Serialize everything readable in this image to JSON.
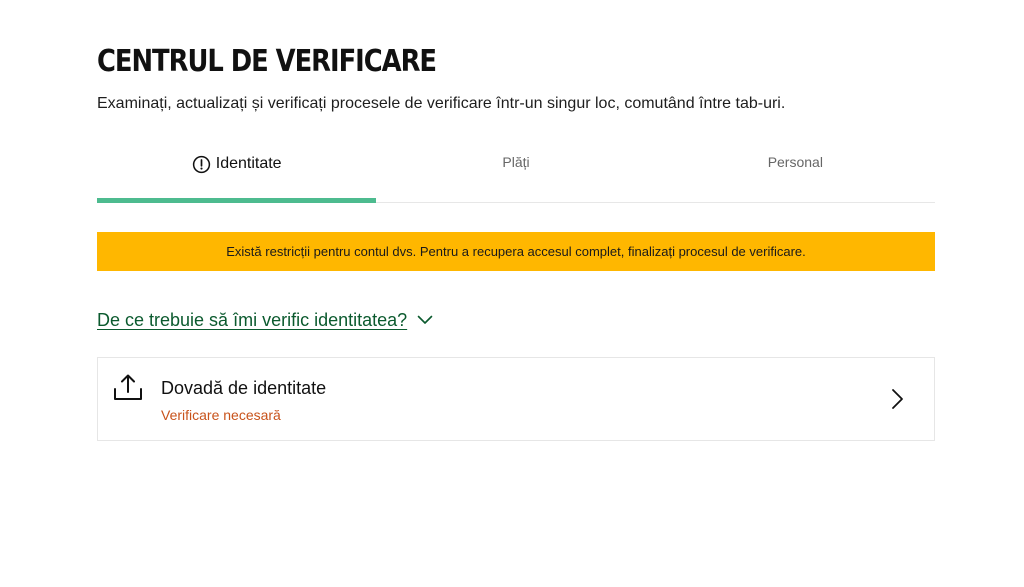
{
  "header": {
    "title": "CENTRUL DE VERIFICARE",
    "subtitle": "Examinați, actualizați și verificați procesele de verificare într-un singur loc, comutând între tab-uri."
  },
  "tabs": [
    {
      "label": "Identitate",
      "active": true,
      "icon": "alert-circle-icon"
    },
    {
      "label": "Plăți",
      "active": false
    },
    {
      "label": "Personal",
      "active": false
    }
  ],
  "alert": {
    "text": "Există restricții pentru contul dvs. Pentru a recupera accesul complet, finalizați procesul de verificare."
  },
  "faq": {
    "label": "De ce trebuie să îmi verific identitatea?",
    "icon": "chevron-down-icon"
  },
  "items": [
    {
      "title": "Dovadă de identitate",
      "status": "Verificare necesară",
      "icon": "upload-icon",
      "action_icon": "chevron-right-icon"
    }
  ],
  "colors": {
    "accent_green": "#4dbb8f",
    "alert_yellow": "#ffb700",
    "link_green": "#0b5a2e",
    "status_orange": "#c8531b"
  }
}
